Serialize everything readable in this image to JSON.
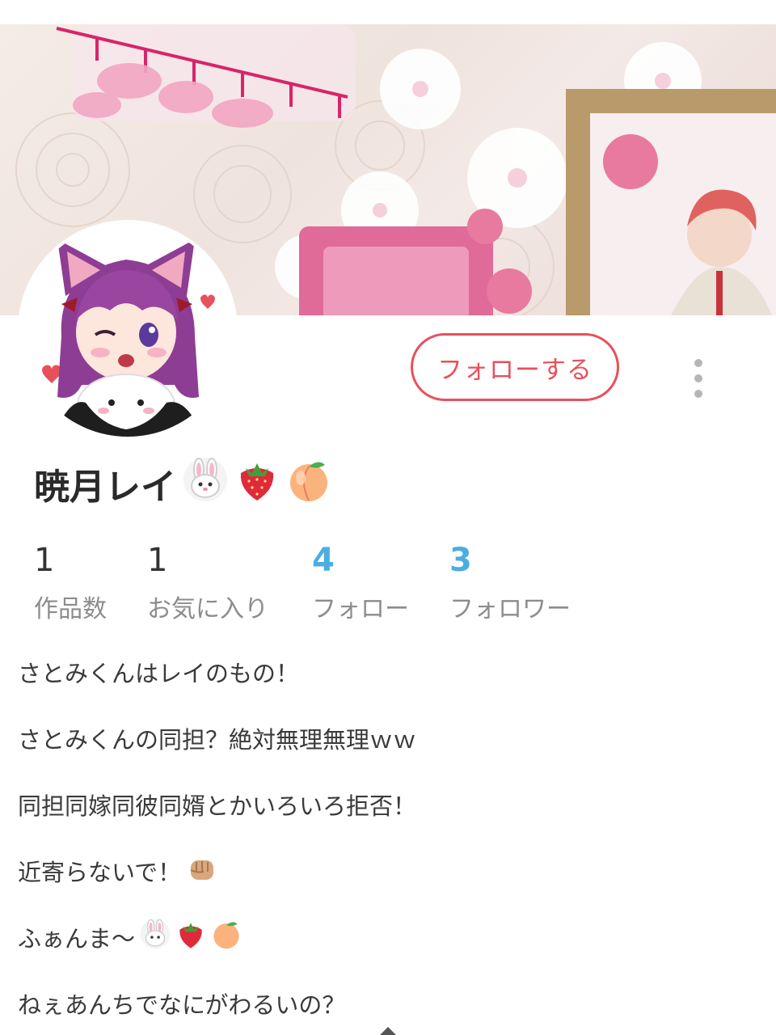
{
  "profile": {
    "name": "暁月レイ",
    "name_emojis": [
      "rabbit-face",
      "strawberry",
      "peach"
    ]
  },
  "actions": {
    "follow_label": "フォローする"
  },
  "stats": [
    {
      "value": "1",
      "label": "作品数",
      "highlight": false
    },
    {
      "value": "1",
      "label": "お気に入り",
      "highlight": false
    },
    {
      "value": "4",
      "label": "フォロー",
      "highlight": true
    },
    {
      "value": "3",
      "label": "フォロワー",
      "highlight": true
    }
  ],
  "bio": [
    "さとみくんはレイのもの！",
    "さとみくんの同担？絶対無理無理ｗｗ",
    "同担同嫁同彼同婿とかいろいろ拒否！",
    "近寄らないで！",
    "ふぁんま〜",
    "ねぇあんちでなにがわるいの？"
  ],
  "colors": {
    "accent_red": "#e8505b",
    "accent_blue": "#4aaee0",
    "label_gray": "#8c8c8c"
  },
  "icons": {
    "menu": "vertical-dots-icon",
    "bio_line_4": "fist-emoji",
    "bio_line_5": [
      "rabbit-face",
      "strawberry",
      "peach"
    ]
  }
}
